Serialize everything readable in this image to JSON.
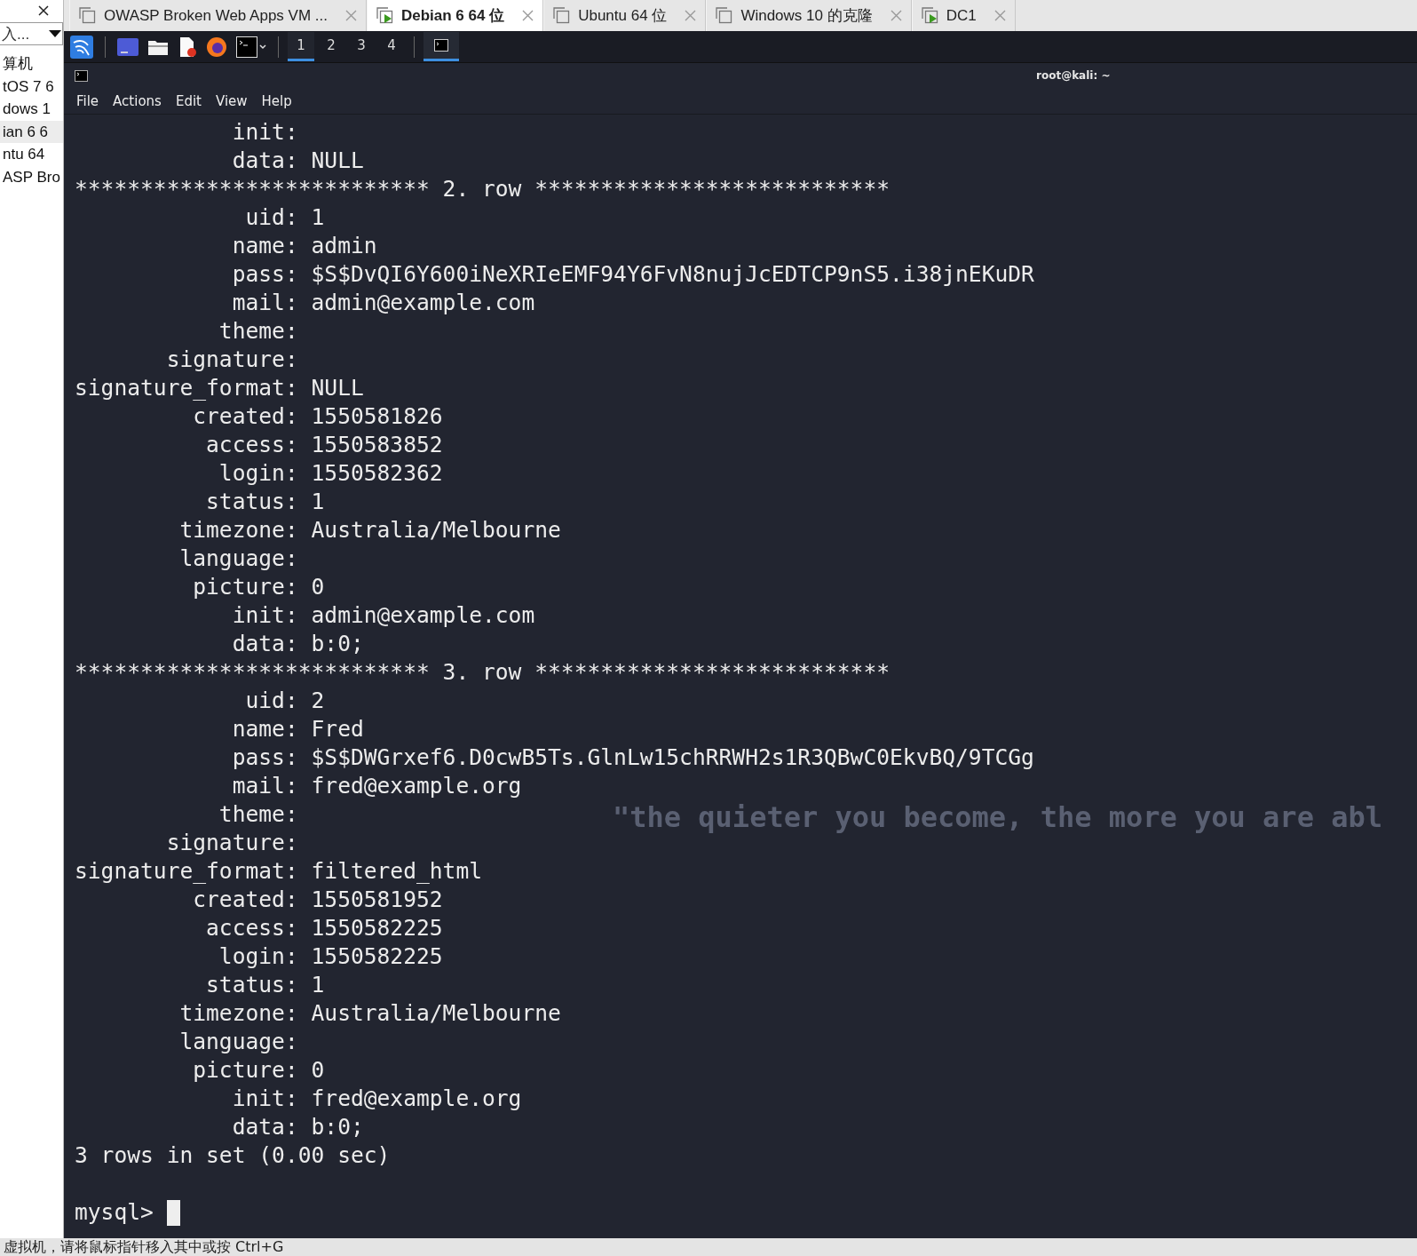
{
  "library": {
    "search": {
      "value": "入..."
    },
    "items": [
      {
        "label": "算机",
        "selected": false
      },
      {
        "label": "tOS 7 6",
        "selected": false
      },
      {
        "label": "dows 1",
        "selected": false
      },
      {
        "label": "ian 6 6",
        "selected": true
      },
      {
        "label": "ntu 64",
        "selected": false
      },
      {
        "label": "ASP Bro",
        "selected": false
      }
    ]
  },
  "tabs": [
    {
      "label": "OWASP Broken Web Apps VM ...",
      "selected": false,
      "running": false
    },
    {
      "label": "Debian 6 64 位",
      "selected": true,
      "running": true
    },
    {
      "label": "Ubuntu 64 位",
      "selected": false,
      "running": false
    },
    {
      "label": "Windows 10 的克隆",
      "selected": false,
      "running": false
    },
    {
      "label": "DC1",
      "selected": false,
      "running": true
    }
  ],
  "panel": {
    "workspaces": [
      {
        "label": "1",
        "selected": true
      },
      {
        "label": "2",
        "selected": false
      },
      {
        "label": "3",
        "selected": false
      },
      {
        "label": "4",
        "selected": false
      }
    ]
  },
  "wallpaper": {
    "quote": "\"the quieter you become, the more you are abl"
  },
  "terminal": {
    "title": "root@kali: ~",
    "menu": [
      "File",
      "Actions",
      "Edit",
      "View",
      "Help"
    ],
    "lines": [
      {
        "kind": "field",
        "field": "init:"
      },
      {
        "kind": "field",
        "field": "data:",
        "value": "NULL"
      },
      {
        "kind": "separator",
        "text": "*************************** 2. row ***************************"
      },
      {
        "kind": "field",
        "field": "uid:",
        "value": "1"
      },
      {
        "kind": "field",
        "field": "name:",
        "value": "admin"
      },
      {
        "kind": "field",
        "field": "pass:",
        "value": "$S$DvQI6Y600iNeXRIeEMF94Y6FvN8nujJcEDTCP9nS5.i38jnEKuDR"
      },
      {
        "kind": "field",
        "field": "mail:",
        "value": "admin@example.com"
      },
      {
        "kind": "field",
        "field": "theme:"
      },
      {
        "kind": "field",
        "field": "signature:"
      },
      {
        "kind": "field",
        "field": "signature_format:",
        "value": "NULL"
      },
      {
        "kind": "field",
        "field": "created:",
        "value": "1550581826"
      },
      {
        "kind": "field",
        "field": "access:",
        "value": "1550583852"
      },
      {
        "kind": "field",
        "field": "login:",
        "value": "1550582362"
      },
      {
        "kind": "field",
        "field": "status:",
        "value": "1"
      },
      {
        "kind": "field",
        "field": "timezone:",
        "value": "Australia/Melbourne"
      },
      {
        "kind": "field",
        "field": "language:"
      },
      {
        "kind": "field",
        "field": "picture:",
        "value": "0"
      },
      {
        "kind": "field",
        "field": "init:",
        "value": "admin@example.com"
      },
      {
        "kind": "field",
        "field": "data:",
        "value": "b:0;"
      },
      {
        "kind": "separator",
        "text": "*************************** 3. row ***************************"
      },
      {
        "kind": "field",
        "field": "uid:",
        "value": "2"
      },
      {
        "kind": "field",
        "field": "name:",
        "value": "Fred"
      },
      {
        "kind": "field",
        "field": "pass:",
        "value": "$S$DWGrxef6.D0cwB5Ts.GlnLw15chRRWH2s1R3QBwC0EkvBQ/9TCGg"
      },
      {
        "kind": "field",
        "field": "mail:",
        "value": "fred@example.org"
      },
      {
        "kind": "field",
        "field": "theme:"
      },
      {
        "kind": "field",
        "field": "signature:"
      },
      {
        "kind": "field",
        "field": "signature_format:",
        "value": "filtered_html"
      },
      {
        "kind": "field",
        "field": "created:",
        "value": "1550581952"
      },
      {
        "kind": "field",
        "field": "access:",
        "value": "1550582225"
      },
      {
        "kind": "field",
        "field": "login:",
        "value": "1550582225"
      },
      {
        "kind": "field",
        "field": "status:",
        "value": "1"
      },
      {
        "kind": "field",
        "field": "timezone:",
        "value": "Australia/Melbourne"
      },
      {
        "kind": "field",
        "field": "language:"
      },
      {
        "kind": "field",
        "field": "picture:",
        "value": "0"
      },
      {
        "kind": "field",
        "field": "init:",
        "value": "fred@example.org"
      },
      {
        "kind": "field",
        "field": "data:",
        "value": "b:0;"
      },
      {
        "kind": "text",
        "text": "3 rows in set (0.00 sec)"
      }
    ],
    "prompt": "mysql>"
  },
  "status_bar": {
    "text": "虚拟机，请将鼠标指针移入其中或按 Ctrl+G"
  }
}
